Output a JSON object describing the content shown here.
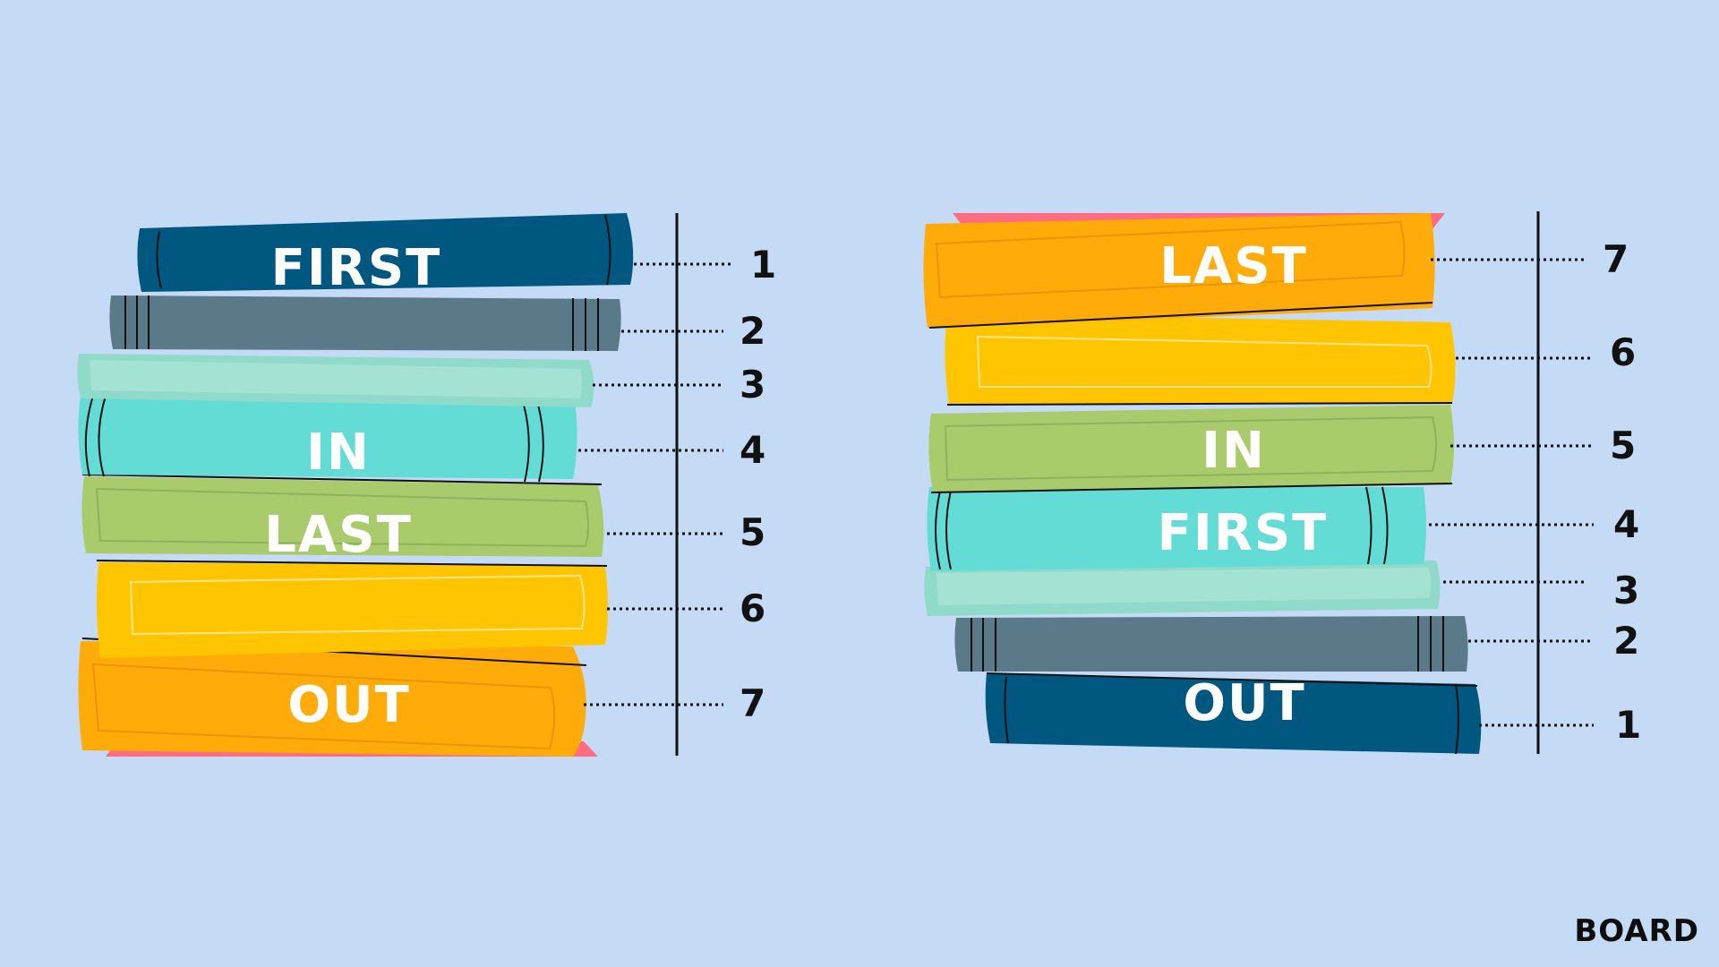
{
  "left_stack": {
    "labels": {
      "top": "FIRST",
      "middle_1": "IN",
      "middle_2": "LAST",
      "bottom": "OUT"
    },
    "numbers": [
      "1",
      "2",
      "3",
      "4",
      "5",
      "6",
      "7"
    ]
  },
  "right_stack": {
    "labels": {
      "top": "LAST",
      "middle_1": "IN",
      "middle_2": "FIRST",
      "bottom": "OUT"
    },
    "numbers": [
      "7",
      "6",
      "5",
      "4",
      "3",
      "2",
      "1"
    ]
  },
  "colors": {
    "background": "#c5daf5",
    "navy": "#005780",
    "slate": "#5a7a8a",
    "mint": "#8fdac8",
    "turquoise": "#62dcd5",
    "green": "#a9cb6c",
    "yellow": "#ffc500",
    "orange": "#ffab0a",
    "pink": "#ff6b81"
  },
  "logo": {
    "text": "BOARD"
  }
}
